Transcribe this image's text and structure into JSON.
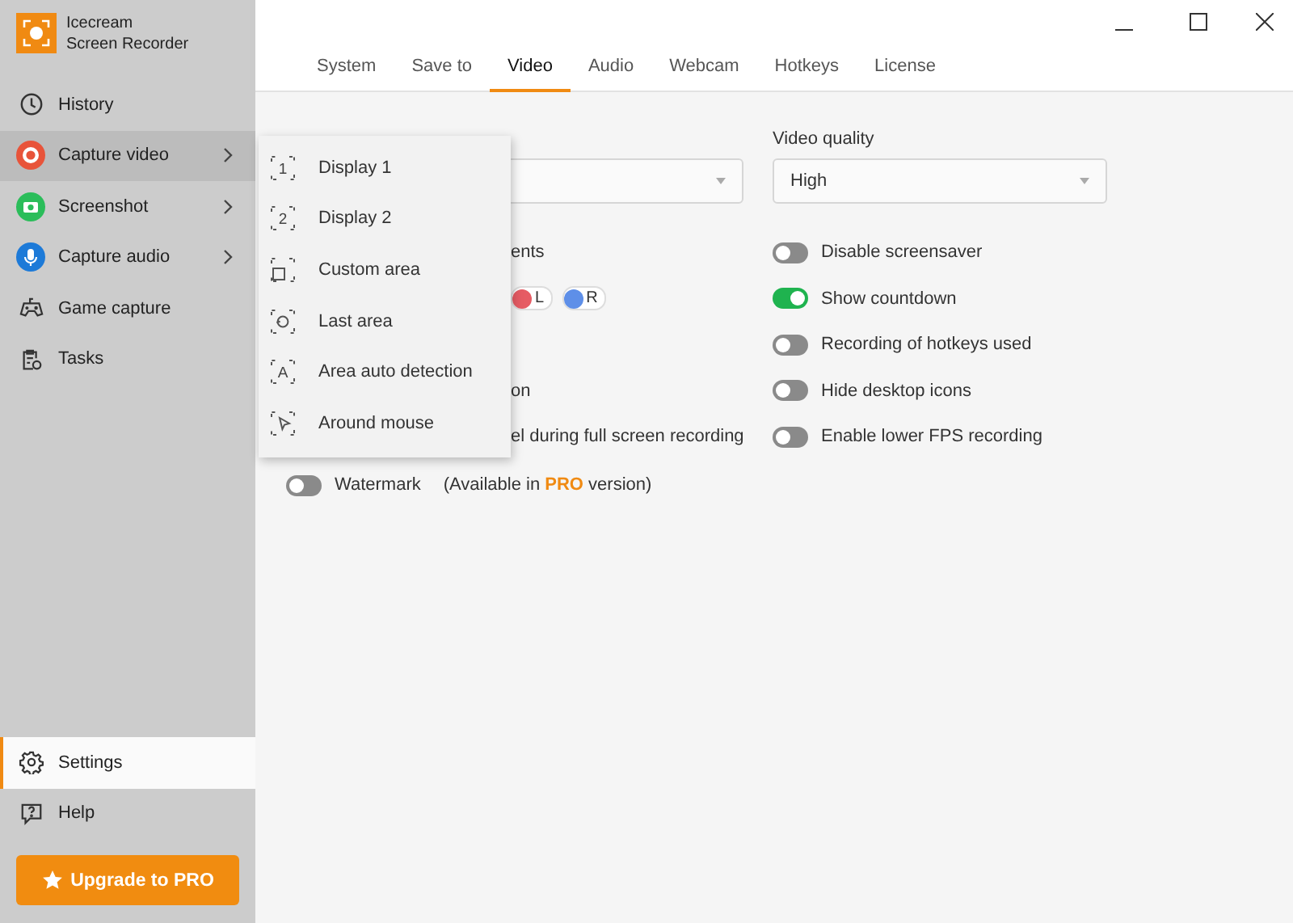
{
  "app": {
    "name": "Icecream",
    "subtitle": "Screen Recorder"
  },
  "nav": [
    {
      "label": "History",
      "selected": false,
      "submenu": false
    },
    {
      "label": "Capture video",
      "selected": true,
      "submenu": true
    },
    {
      "label": "Screenshot",
      "selected": false,
      "submenu": true
    },
    {
      "label": "Capture audio",
      "selected": false,
      "submenu": true
    },
    {
      "label": "Game capture",
      "selected": false,
      "submenu": false
    },
    {
      "label": "Tasks",
      "selected": false,
      "submenu": false
    }
  ],
  "bottom_nav": [
    {
      "label": "Settings",
      "selected": true
    },
    {
      "label": "Help",
      "selected": false
    }
  ],
  "upgrade_button": "Upgrade to PRO",
  "tabs": [
    {
      "label": "System",
      "selected": false
    },
    {
      "label": "Save to",
      "selected": false
    },
    {
      "label": "Video",
      "selected": true
    },
    {
      "label": "Audio",
      "selected": false
    },
    {
      "label": "Webcam",
      "selected": false
    },
    {
      "label": "Hotkeys",
      "selected": false
    },
    {
      "label": "License",
      "selected": false
    }
  ],
  "video_format": {
    "kind": "dropdown"
  },
  "left_options": [
    {
      "kind": "text",
      "text": "ents"
    },
    {
      "kind": "chips",
      "chips": [
        {
          "label": "L",
          "color": "#e65c64"
        },
        {
          "label": "R",
          "color": "#5e8fe8"
        }
      ]
    },
    {
      "kind": "blank"
    },
    {
      "kind": "text",
      "text": "on"
    },
    {
      "kind": "text",
      "text": "el during full screen recording"
    }
  ],
  "watermark": {
    "label": "Watermark",
    "on": false,
    "note": "(Available in **PRO** version)"
  },
  "video_quality": {
    "label": "Video quality",
    "value": "High"
  },
  "toggles": [
    {
      "label": "Disable screensaver",
      "on": false
    },
    {
      "label": "Show countdown",
      "on": true
    },
    {
      "label": "Recording of hotkeys used",
      "on": false
    },
    {
      "label": "Hide desktop icons",
      "on": false
    },
    {
      "label": "Enable lower FPS recording",
      "on": false
    }
  ],
  "capture_menu": [
    {
      "label": "Display 1",
      "icon_text": "1"
    },
    {
      "label": "Display 2",
      "icon_text": "2"
    },
    {
      "label": "Custom area"
    },
    {
      "label": "Last area"
    },
    {
      "label": "Area auto detection",
      "icon_text": "A"
    },
    {
      "label": "Around mouse"
    }
  ]
}
